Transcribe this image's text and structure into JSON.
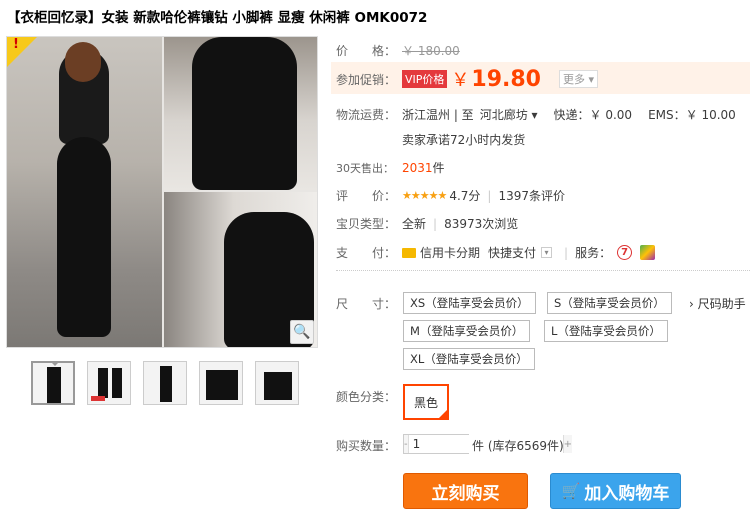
{
  "product": {
    "title": "【衣柜回忆录】女装 新款哈伦裤镶钻 小脚裤 显瘦 休闲裤 OMK0072",
    "badge": "!"
  },
  "gallery": {
    "zoom_icon": "magnifier-icon",
    "thumbnail_count": 5
  },
  "price": {
    "label": "价　　格：",
    "original": "￥ 180.00"
  },
  "promo": {
    "label": "参加促销：",
    "vip_tag": "VIP价格",
    "currency": "￥",
    "price": "19.80",
    "more": "更多 ▾"
  },
  "shipping": {
    "label": "物流运费：",
    "route": "浙江温州 | 至",
    "destination": "河北廊坊 ▾",
    "express": "快递：￥ 0.00",
    "ems": "EMS：￥ 10.00",
    "promise": "卖家承诺72小时内发货"
  },
  "sales": {
    "label": "30天售出：",
    "count": "2031",
    "unit": "件"
  },
  "rating": {
    "label": "评　　价：",
    "stars": "★★★★★",
    "score": "4.7分",
    "reviews": "1397条评价"
  },
  "item_type": {
    "label": "宝贝类型：",
    "condition": "全新",
    "views": "83973次浏览"
  },
  "payment": {
    "label": "支　　付：",
    "credit": "信用卡分期",
    "quick": "快捷支付",
    "service_label": "服务："
  },
  "size": {
    "label": "尺　　寸：",
    "options": [
      "XS（登陆享受会员价）",
      "S（登陆享受会员价）",
      "M（登陆享受会员价）",
      "L（登陆享受会员价）",
      "XL（登陆享受会员价）"
    ],
    "helper": "› 尺码助手"
  },
  "color": {
    "label": "颜色分类：",
    "selected": "黑色"
  },
  "quantity": {
    "label": "购买数量：",
    "value": "1",
    "stock": "件 (库存6569件)"
  },
  "actions": {
    "buy_now": "立刻购买",
    "add_to_cart": "加入购物车"
  },
  "colors": {
    "accent": "#ff4400",
    "buy_button": "#f9740f",
    "cart_button": "#3ba4ec"
  }
}
